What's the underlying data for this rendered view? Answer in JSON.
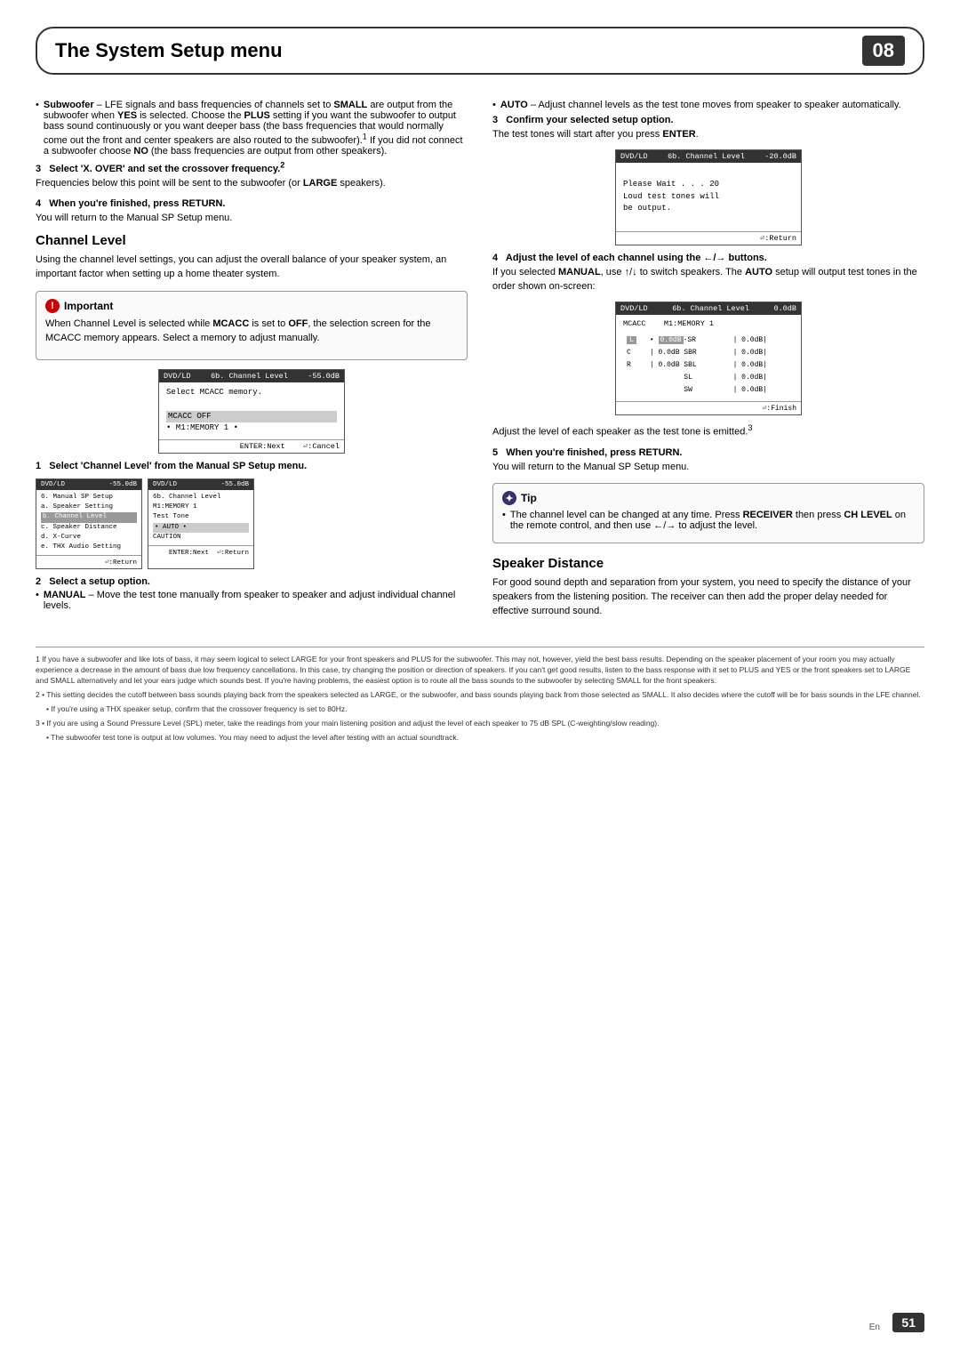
{
  "header": {
    "title": "The System Setup menu",
    "chapter": "08"
  },
  "left_col": {
    "bullet1_title": "Subwoofer",
    "bullet1_text": " – LFE signals and bass frequencies of channels set to ",
    "bullet1_bold1": "SMALL",
    "bullet1_text2": " are output from the subwoofer when ",
    "bullet1_bold2": "YES",
    "bullet1_text3": " is selected. Choose the ",
    "bullet1_bold3": "PLUS",
    "bullet1_text4": " setting if you want the subwoofer to output bass sound continuously or you want deeper bass (the bass frequencies that would normally come out the front and center speakers are also routed to the subwoofer).",
    "bullet1_sup": "1",
    "bullet1_text5": " If you did not connect a subwoofer choose ",
    "bullet1_bold4": "NO",
    "bullet1_text6": " (the bass frequencies are output from other speakers).",
    "step3_title": "3   Select 'X. OVER' and set the crossover frequency.",
    "step3_sup": "2",
    "step3_text": "Frequencies below this point will be sent to the subwoofer (or ",
    "step3_bold": "LARGE",
    "step3_text2": " speakers).",
    "step4_title": "4   When you're finished, press RETURN.",
    "step4_text": "You will return to the Manual SP Setup menu.",
    "channel_level_heading": "Channel Level",
    "channel_level_intro": "Using the channel level settings, you can adjust the overall balance of your speaker system, an important factor when setting up a home theater system.",
    "important_label": "Important",
    "important_text1": "When Channel Level is selected while ",
    "important_bold1": "MCACC",
    "important_text2": " is set to ",
    "important_bold2": "OFF",
    "important_text3": ", the selection screen for the MCACC memory appears. Select a memory to adjust manually.",
    "screen1_header_left": "DVD/LD",
    "screen1_header_right": "-55.0dB",
    "screen1_sub_header": "6b. Channel Level",
    "screen1_line1": "Select MCACC memory.",
    "screen1_line2": "",
    "screen1_highlight": "MCACC OFF",
    "screen1_option": "• M1:MEMORY 1 •",
    "screen1_footer_left": "ENTER:Next",
    "screen1_footer_right": "⏎:Cancel",
    "step1_title": "1   Select 'Channel Level' from the Manual SP Setup menu.",
    "screen_row_left_header_left": "DVD/LD",
    "screen_row_left_header_right": "-55.0dB",
    "screen_row_left_subheader": "6. Manual SP Setup",
    "screen_row_left_line1": "a. Speaker Setting",
    "screen_row_left_highlight": "b. Channel Level",
    "screen_row_left_line2": "c. Speaker Distance",
    "screen_row_left_line3": "d. X-Curve",
    "screen_row_left_line4": "e. THX Audio Setting",
    "screen_row_left_footer": "⏎:Return",
    "screen_row_right_header_left": "DVD/LD",
    "screen_row_right_header_right": "-55.0dB",
    "screen_row_right_subheader": "6b. Channel Level",
    "screen_row_right_subheader2": "6b. Channel Level   M1:MEMORY 1",
    "screen_row_right_line1": "Test Tone",
    "screen_row_right_highlight": "• AUTO •",
    "screen_row_right_caution": "CAUTION",
    "screen_row_right_footer_left": "⏎:Return",
    "screen_row_right_footer_right": "ENTER:Next  ⏎:Return",
    "step2_title": "2   Select a setup option.",
    "manual_title": "MANUAL",
    "manual_text": " – Move the test tone manually from speaker to speaker and adjust individual channel levels."
  },
  "right_col": {
    "auto_title": "AUTO",
    "auto_text": " – Adjust channel levels as the test tone moves from speaker to speaker automatically.",
    "step3_title": "3   Confirm your selected setup option.",
    "step3_text": "The test tones will start after you press ",
    "step3_bold": "ENTER",
    "screen2_header_left": "DVD/LD",
    "screen2_header_right": "-20.0dB",
    "screen2_subheader": "6b. Channel Level",
    "screen2_line1": "Please Wait . . . 20",
    "screen2_line2": "Loud test tones will",
    "screen2_line3": "be output.",
    "screen2_footer": "⏎:Return",
    "step4_title": "4   Adjust the level of each channel using the ←/→ buttons.",
    "step4_text1": "If you selected ",
    "step4_bold1": "MANUAL",
    "step4_text2": ", use ↑/↓ to switch speakers. The ",
    "step4_bold2": "AUTO",
    "step4_text3": " setup will output test tones in the order shown on-screen:",
    "screen3_header_left": "DVD/LD",
    "screen3_header_right": "0.0dB",
    "screen3_subheader": "6b. Channel Level",
    "screen3_subheader2": "MCACC   M1:MEMORY 1",
    "screen3_l": "L",
    "screen3_c": "C",
    "screen3_r": "R",
    "screen3_sr": "SR",
    "screen3_sbl": "SBL",
    "screen3_sbr": "SBR",
    "screen3_sl": "SL",
    "screen3_sw": "SW",
    "screen3_l_val": "0.0dB",
    "screen3_c_val": "0.0dB",
    "screen3_r_val": "0.0dB",
    "screen3_sr_val": "0.0dB",
    "screen3_sbl_val": "0.0dB",
    "screen3_sbr_val": "0.0dB",
    "screen3_sl_val": "0.0dB",
    "screen3_sw_val": "0.0dB",
    "screen3_footer": "⏎:Finish",
    "step3_emitted_text": "Adjust the level of each speaker as the test tone is emitted.",
    "step3_emitted_sup": "3",
    "step5_title": "5   When you're finished, press RETURN.",
    "step5_text": "You will return to the Manual SP Setup menu.",
    "tip_label": "Tip",
    "tip_text1": "The channel level can be changed at any time. Press ",
    "tip_bold1": "RECEIVER",
    "tip_text2": " then press ",
    "tip_bold2": "CH LEVEL",
    "tip_text3": " on the remote control, and then use ←/→ to adjust the level.",
    "speaker_distance_heading": "Speaker Distance",
    "speaker_distance_text": "For good sound depth and separation from your system, you need to specify the distance of your speakers from the listening position. The receiver can then add the proper delay needed for effective surround sound."
  },
  "footer_notes": {
    "note1": "1  If you have a subwoofer and like lots of bass, it may seem logical to select LARGE for your front speakers and PLUS for the subwoofer. This may not, however, yield the best bass results. Depending on the speaker placement of your room you may actually experience a decrease in the amount of bass due low frequency cancellations. In this case, try changing the position or direction of speakers. If you can't get good results, listen to the bass response with it set to PLUS and YES or the front speakers set to LARGE and SMALL alternatively and let your ears judge which sounds best. If you're having problems, the easiest option is to route all the bass sounds to the subwoofer by selecting SMALL for the front speakers.",
    "note2": "2  • This setting decides the cutoff between bass sounds playing back from the speakers selected as LARGE, or the subwoofer, and bass sounds playing back from those selected as SMALL. It also decides where the cutoff will be for bass sounds in the LFE channel.",
    "note2b": "• If you're using a THX speaker setup, confirm that the crossover frequency is set to 80Hz.",
    "note3": "3  • If you are using a Sound Pressure Level (SPL) meter, take the readings from your main listening position and adjust the level of each speaker to 75 dB SPL (C-weighting/slow reading).",
    "note3b": "• The subwoofer test tone is output at low volumes. You may need to adjust the level after testing with an actual soundtrack."
  },
  "page": {
    "number": "51",
    "lang": "En"
  }
}
